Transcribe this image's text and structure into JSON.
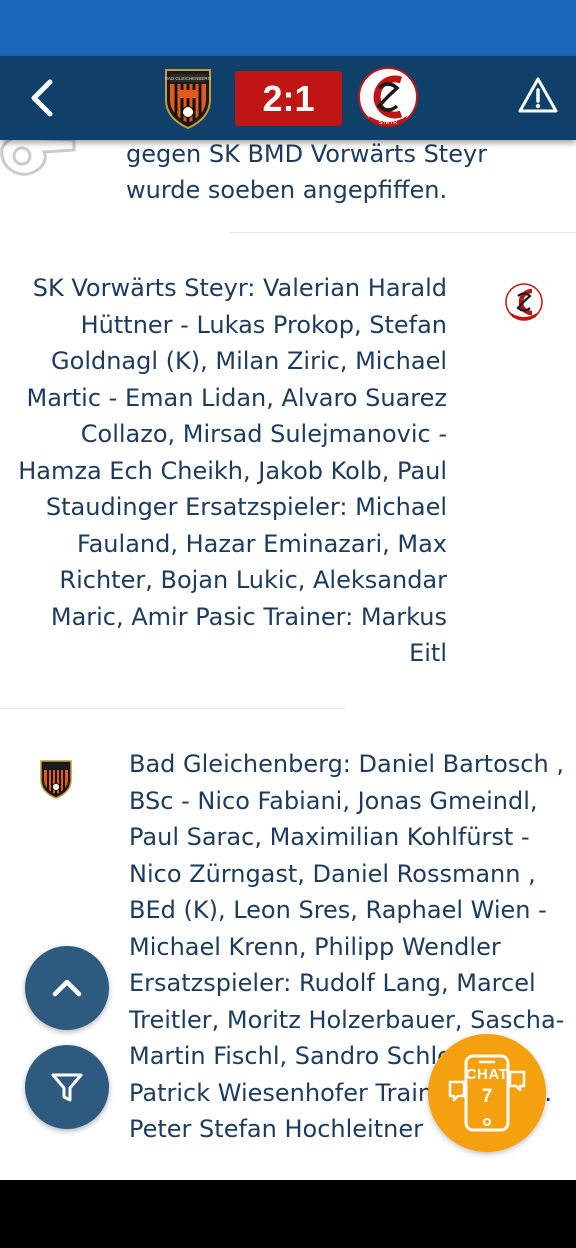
{
  "header": {
    "score": "2:1",
    "home_crest_icon": "bad-gleichenberg-crest",
    "home_crest_text": "BAD GLEICHENBERG",
    "away_crest_icon": "sk-vorwaerts-steyr-crest",
    "away_crest_text": "STEYR",
    "back_icon": "chevron-left-icon",
    "alert_icon": "warning-triangle-icon"
  },
  "feed": {
    "event_text": "gegen SK BMD Vorwärts Steyr wurde soeben angepfiffen.",
    "away_lineup": "SK Vorwärts Steyr: Valerian Harald Hüttner - Lukas Prokop, Stefan Goldnagl (K), Milan Ziric, Michael Martic - Eman Lidan, Alvaro Suarez Collazo, Mirsad Sulejmanovic - Hamza Ech Cheikh, Jakob Kolb, Paul Staudinger Ersatzspieler: Michael Fauland, Hazar Eminazari, Max Richter, Bojan Lukic, Aleksandar Maric, Amir Pasic Trainer: Markus Eitl",
    "home_lineup": "Bad Gleichenberg: Daniel Bartosch , BSc - Nico Fabiani, Jonas Gmeindl, Paul Sarac, Maximilian Kohlfürst - Nico Zürngast, Daniel Rossmann , BEd (K), Leon Sres, Raphael Wien - Michael Krenn, Philipp Wendler Ersatzspieler: Rudolf Lang, Marcel Treitler, Moritz Holzerbauer, Sascha-Martin Fischl, Sandro Schleich, Patrick Wiesenhofer Trainer: MMag. Peter Stefan Hochleitner"
  },
  "fabs": {
    "up_icon": "chevron-up-icon",
    "filter_icon": "funnel-icon"
  },
  "chat": {
    "label": "CHAT",
    "count": "7"
  },
  "colors": {
    "status_bar": "#1a66b8",
    "header": "#0f4069",
    "score_box": "#c01515",
    "text": "#1d3b5c",
    "fab": "#2e5a80",
    "chat_fab": "#f5a00f"
  }
}
